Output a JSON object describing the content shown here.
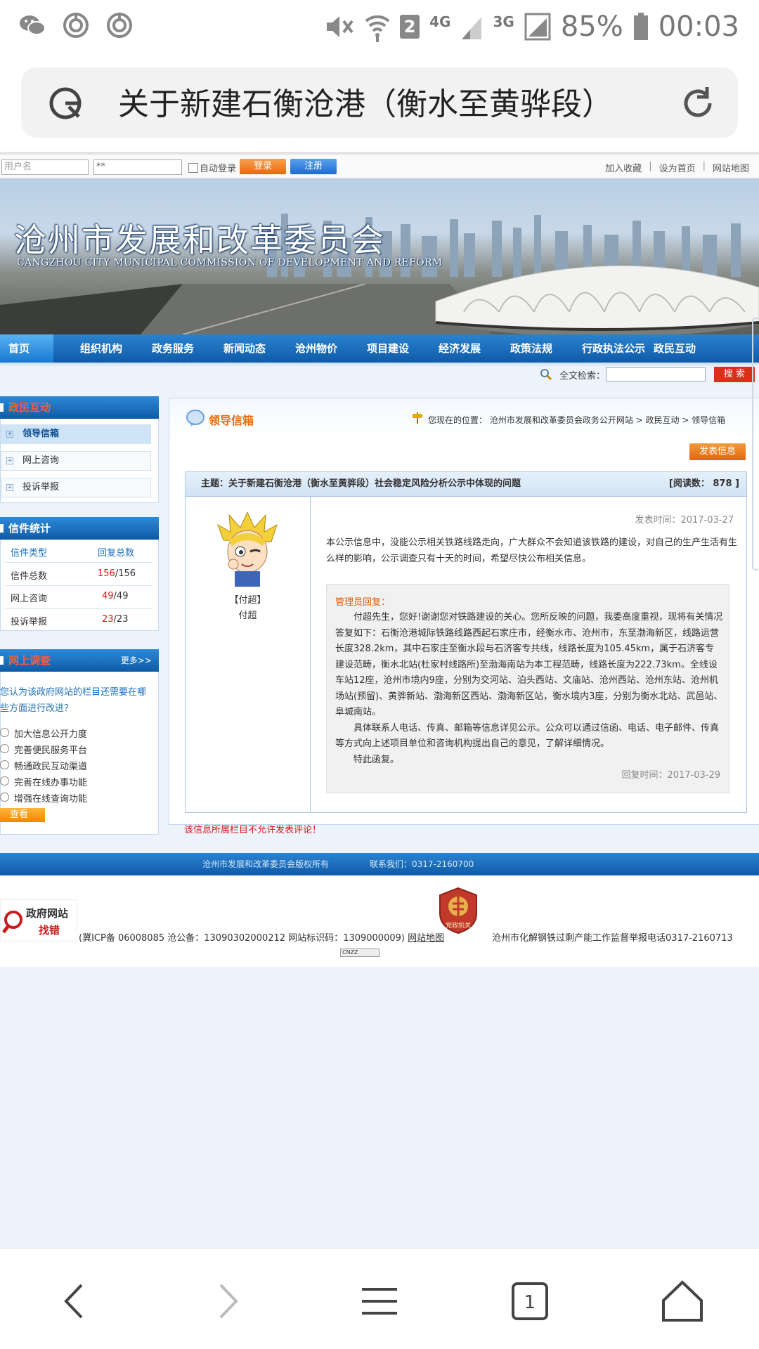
{
  "statusbar": {
    "sim_slot": "2",
    "net_4g": "4G",
    "net_3g": "3G",
    "battery": "85%",
    "time": "00:03"
  },
  "browser": {
    "url_title": "关于新建石衡沧港（衡水至黄骅段）"
  },
  "topbar": {
    "username_placeholder": "用户名",
    "password_value": "**",
    "auto_login": "自动登录",
    "login": "登录",
    "register": "注册",
    "links": [
      "加入收藏",
      "设为首页",
      "网站地图"
    ],
    "sep": "|"
  },
  "banner": {
    "title": "沧州市发展和改革委员会",
    "subtitle": "CANGZHOU CITY MUNICIPAL COMMISSION OF DEVELOPMENT AND REFORM"
  },
  "nav": [
    "首页",
    "组织机构",
    "政务服务",
    "新闻动态",
    "沧州物价",
    "项目建设",
    "经济发展",
    "政策法规",
    "行政执法公示",
    "政民互动"
  ],
  "search": {
    "label": "全文检索：",
    "button": "搜 索"
  },
  "sidebar": {
    "section1_title": "政民互动",
    "section1_items": [
      "领导信箱",
      "网上咨询",
      "投诉举报"
    ],
    "stats_title": "信件统计",
    "stats_headers": [
      "信件类型",
      "回复总数"
    ],
    "stats_rows": [
      {
        "type": "信件总数",
        "replied": "156",
        "total": "/156"
      },
      {
        "type": "网上咨询",
        "replied": "49",
        "total": "/49"
      },
      {
        "type": "投诉举报",
        "replied": "23",
        "total": "/23"
      }
    ],
    "survey_title": "网上调查",
    "survey_more": "更多>>",
    "survey_question": "您认为该政府网站的栏目还需要在哪些方面进行改进？",
    "survey_options": [
      "加大信息公开力度",
      "完善便民服务平台",
      "畅通政民互动渠道",
      "完善在线办事功能",
      "增强在线查询功能"
    ],
    "view_button": "查看"
  },
  "main": {
    "title": "领导信箱",
    "location": "您现在的位置： 沧州市发展和改革委员会政务公开网站 > 政民互动 > 领导信箱",
    "post_button": "发表信息",
    "topic": "主题：关于新建石衡沧港（衡水至黄骅段）社会稳定风险分析公示中体现的问题",
    "reads": "[阅读数： 878 ]",
    "author_bracket": "【付超】",
    "author_name": "付超",
    "post_time": "发表时间：2017-03-27",
    "message": "本公示信息中，没能公示相关铁路线路走向，广大群众不会知道该铁路的建设，对自己的生产生活有生么样的影响，公示调查只有十天的时间，希望尽快公布相关信息。",
    "reply_label": "管理员回复：",
    "reply_p1": "付超先生，您好!谢谢您对铁路建设的关心。您所反映的问题，我委高度重视，现将有关情况答复如下：石衡沧港城际铁路线路西起石家庄市，经衡水市、沧州市，东至渤海新区，线路运营长度328.2km，其中石家庄至衡水段与石济客专共线，线路长度为105.45km，属于石济客专建设范畴，衡水北站(杜家村线路所)至渤海南站为本工程范畴，线路长度为222.73km。全线设车站12座，沧州市境内9座，分别为交河站、泊头西站、文庙站、沧州西站、沧州东站、沧州机场站(预留)、黄骅新站、渤海新区西站、渤海新区站，衡水境内3座，分别为衡水北站、武邑站、阜城南站。",
    "reply_p2": "具体联系人电话、传真、邮箱等信息详见公示。公众可以通过信函、电话、电子邮件、传真等方式向上述项目单位和咨询机构提出自己的意见，了解详细情况。",
    "reply_p3": "特此函复。",
    "reply_time": "回复时间：2017-03-29",
    "no_comment": "该信息所属栏目不允许发表评论！"
  },
  "footer": {
    "copyright": "沧州市发展和改革委员会版权所有",
    "contact": "联系我们：0317-2160700",
    "gov_line1": "政府网站",
    "gov_line2": "找错",
    "icp": "(冀ICP备 06008085 沧公备：13090302000212 网站标识码：1309000009)",
    "sitemap": "网站地图",
    "report": "沧州市化解钢铁过剩产能工作监督举报电话0317-2160713",
    "dang_badge": "党政机关",
    "cnzz": "CNZZ"
  },
  "colors": {
    "nav_blue": "#0f5aa8",
    "accent_orange": "#e86a0e",
    "alert_red": "#d81818"
  }
}
